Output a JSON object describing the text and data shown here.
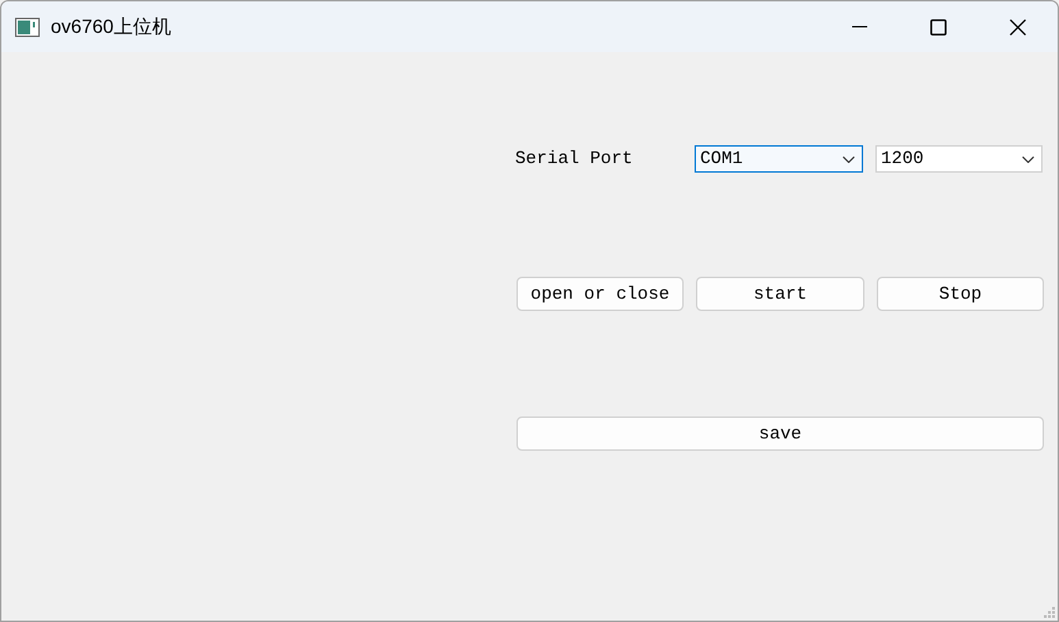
{
  "window": {
    "title": "ov6760上位机"
  },
  "serial_port": {
    "label": "Serial Port",
    "port": {
      "value": "COM1",
      "focused": true
    },
    "baud": {
      "value": "1200",
      "focused": false
    }
  },
  "buttons": [
    {
      "label": "open or close"
    },
    {
      "label": "start"
    },
    {
      "label": "Stop"
    }
  ],
  "save_button": {
    "label": "save"
  }
}
